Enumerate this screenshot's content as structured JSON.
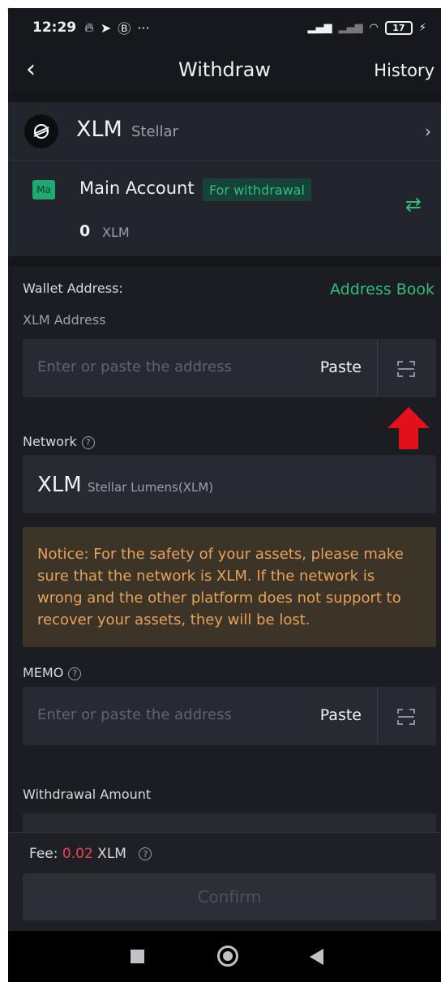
{
  "status_bar": {
    "time": "12:29",
    "battery": "17"
  },
  "header": {
    "title": "Withdraw",
    "history": "History"
  },
  "coin": {
    "symbol": "XLM",
    "name": "Stellar"
  },
  "account": {
    "badge": "Ma",
    "name": "Main Account",
    "tag": "For withdrawal",
    "balance": "0",
    "unit": "XLM"
  },
  "wallet": {
    "label": "Wallet Address:",
    "address_book": "Address Book",
    "sub_label": "XLM Address",
    "placeholder": "Enter or paste the address",
    "paste": "Paste"
  },
  "network": {
    "label": "Network",
    "symbol": "XLM",
    "description": "Stellar Lumens(XLM)"
  },
  "notice": {
    "text": "Notice: For the safety of your assets, please make sure that the network is XLM. If the network is wrong and the other platform does not support to recover your assets, they will be lost."
  },
  "memo": {
    "label": "MEMO",
    "placeholder": "Enter or paste the address",
    "paste": "Paste"
  },
  "amount": {
    "label": "Withdrawal Amount"
  },
  "fee": {
    "label": "Fee:",
    "value": "0.02",
    "unit": "XLM"
  },
  "confirm": {
    "label": "Confirm"
  },
  "colors": {
    "accent_green": "#2fbf7c",
    "notice_text": "#e8a15a",
    "fee_red": "#e8454f",
    "arrow_red": "#e3101c"
  }
}
